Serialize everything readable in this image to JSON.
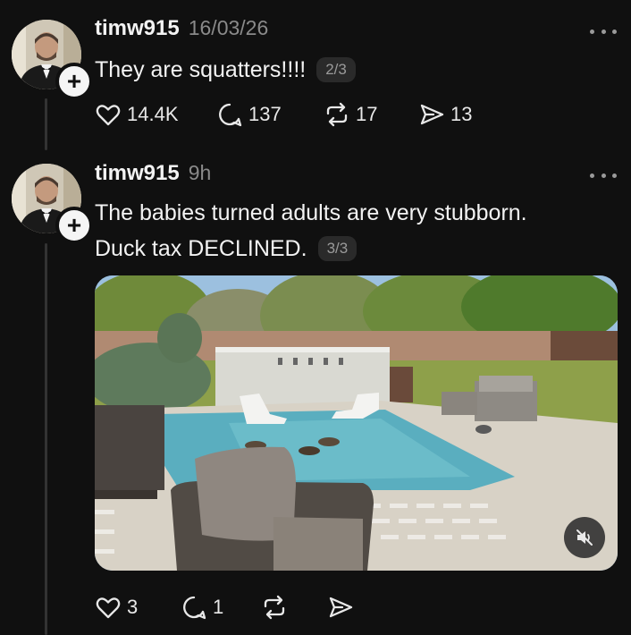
{
  "posts": [
    {
      "username": "timw915",
      "timestamp": "16/03/26",
      "text": "They are squatters!!!!",
      "counter": "2/3",
      "likes": "14.4K",
      "replies": "137",
      "reposts": "17",
      "shares": "13"
    },
    {
      "username": "timw915",
      "timestamp": "9h",
      "text_line1": "The babies turned adults are very stubborn.",
      "text_line2": "Duck tax DECLINED.",
      "counter": "3/3",
      "likes": "3",
      "replies": "1"
    }
  ],
  "colors": {
    "background": "#101010",
    "text": "#f3f3f3",
    "muted": "#8a8a8a",
    "thread_line": "#333333"
  }
}
